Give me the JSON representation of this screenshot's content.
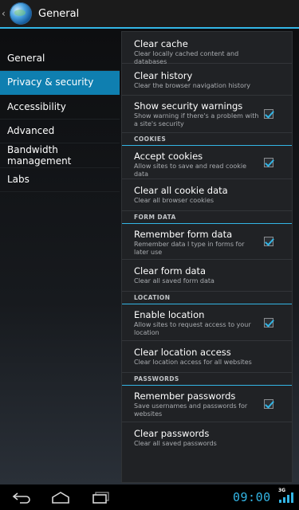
{
  "action_bar": {
    "title": "General"
  },
  "headers": [
    {
      "label": "General",
      "active": false
    },
    {
      "label": "Privacy & security",
      "active": true
    },
    {
      "label": "Accessibility",
      "active": false
    },
    {
      "label": "Advanced",
      "active": false
    },
    {
      "label": "Bandwidth management",
      "active": false
    },
    {
      "label": "Labs",
      "active": false
    }
  ],
  "prefs": {
    "clear_cache": {
      "title": "Clear cache",
      "summary": "Clear locally cached content and databases"
    },
    "clear_history": {
      "title": "Clear history",
      "summary": "Clear the browser navigation history"
    },
    "security_warnings": {
      "title": "Show security warnings",
      "summary": "Show warning if there's a problem with a site's security",
      "checked": true
    },
    "cat_cookies": "COOKIES",
    "accept_cookies": {
      "title": "Accept cookies",
      "summary": "Allow sites to save and read cookie data",
      "checked": true
    },
    "clear_cookies": {
      "title": "Clear all cookie data",
      "summary": "Clear all browser cookies"
    },
    "cat_form": "FORM DATA",
    "remember_form": {
      "title": "Remember form data",
      "summary": "Remember data I type in forms for later use",
      "checked": true
    },
    "clear_form": {
      "title": "Clear form data",
      "summary": "Clear all saved form data"
    },
    "cat_location": "LOCATION",
    "enable_location": {
      "title": "Enable location",
      "summary": "Allow sites to request access to your location",
      "checked": true
    },
    "clear_location": {
      "title": "Clear location access",
      "summary": "Clear location access for all websites"
    },
    "cat_passwords": "PASSWORDS",
    "remember_passwords": {
      "title": "Remember passwords",
      "summary": "Save usernames and passwords for websites",
      "checked": true
    },
    "clear_passwords": {
      "title": "Clear passwords",
      "summary": "Clear all saved passwords"
    }
  },
  "status": {
    "time": "09:00",
    "network": "3G"
  },
  "colors": {
    "accent": "#33b5e5",
    "selected_header": "#0f7fb0"
  },
  "icons": {
    "app": "browser-globe-icon",
    "back": "back-icon",
    "home": "home-icon",
    "recent": "recent-apps-icon",
    "signal": "signal-icon",
    "check": "checkmark-icon"
  }
}
